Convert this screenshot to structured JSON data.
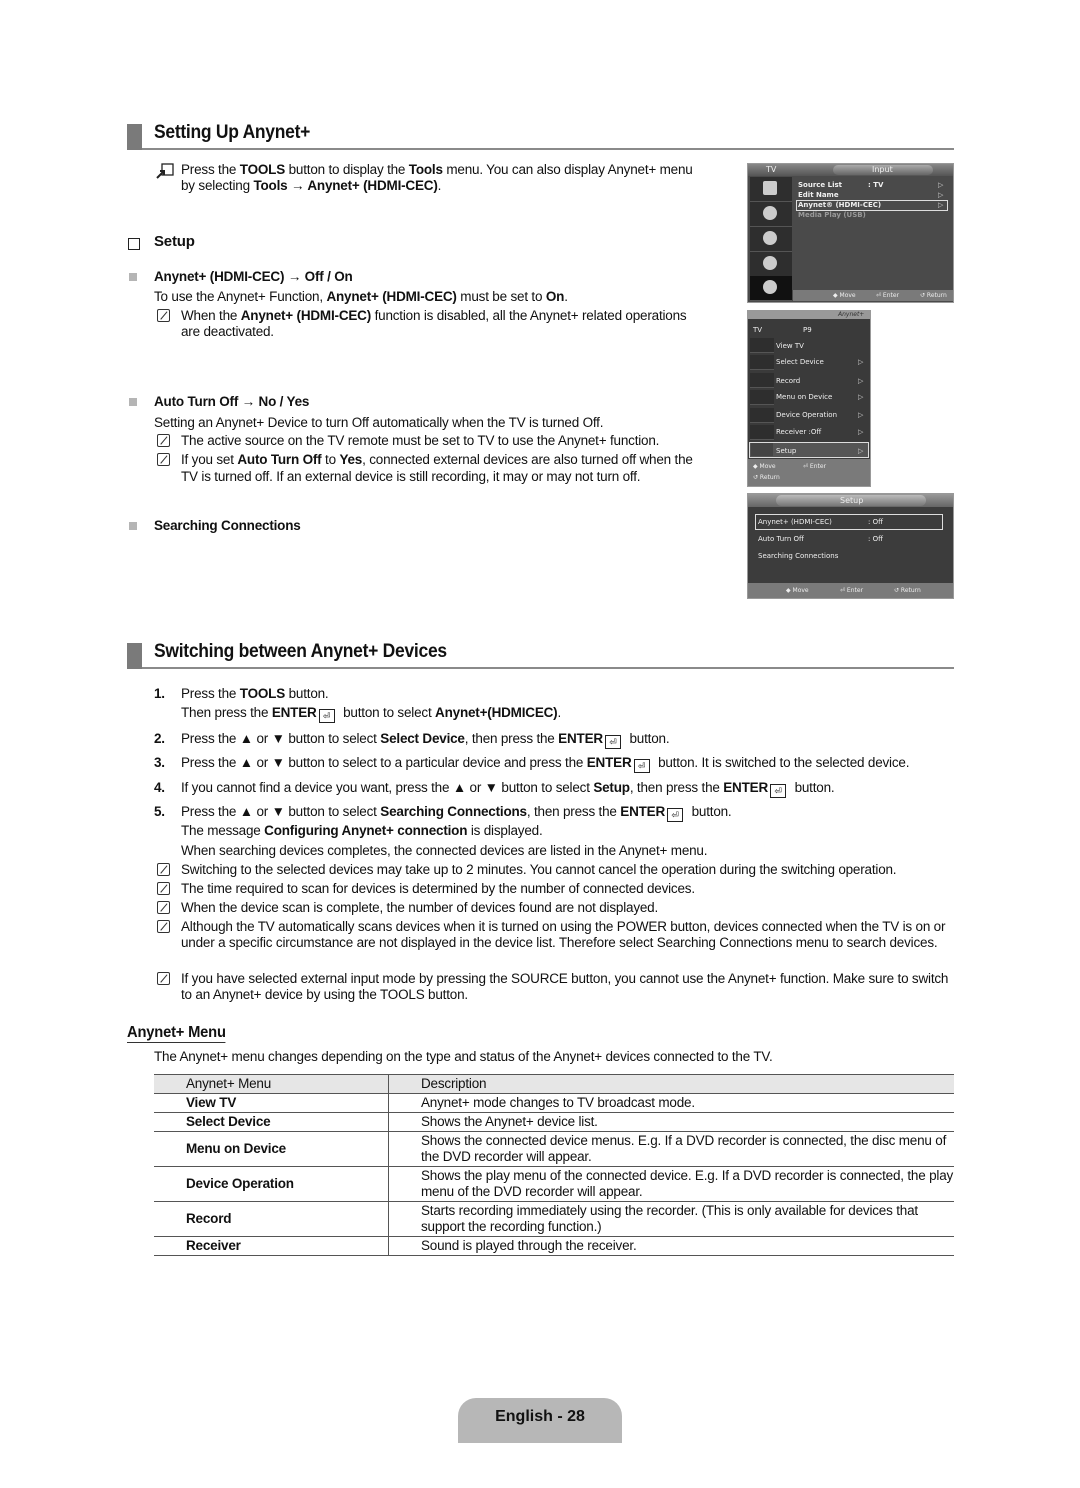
{
  "section1": {
    "title": "Setting Up Anynet+",
    "tools_note": [
      "Press the ",
      "TOOLS",
      " button to display the ",
      "Tools",
      " menu. You can also display Anynet+ menu",
      "by selecting ",
      "Tools → Anynet+ (HDMI-CEC)",
      "."
    ],
    "setup_heading": "Setup",
    "items": [
      {
        "label": "Anynet+ (HDMI-CEC) → Off / On",
        "desc": [
          "To use the Anynet+ Function, ",
          "Anynet+ (HDMI-CEC)",
          " must be set to ",
          "On",
          "."
        ],
        "notes": [
          [
            "When the ",
            "Anynet+ (HDMI-CEC)",
            " function is disabled, all the Anynet+ related operations",
            "are deactivated."
          ]
        ]
      },
      {
        "label": "Auto Turn Off → No / Yes",
        "desc": [
          "Setting an Anynet+ Device to turn Off automatically when the TV is turned Off."
        ],
        "notes": [
          [
            "The active source on the TV remote must be set to TV to use the Anynet+ function."
          ],
          [
            "If you set ",
            "Auto Turn Off",
            " to ",
            "Yes",
            ", connected external devices are also turned off when the",
            "TV is turned off. If an external device is still recording, it may or may not turn off."
          ]
        ]
      },
      {
        "label": "Searching Connections"
      }
    ]
  },
  "osd_input": {
    "tab_left": "TV",
    "tab_title": "Input",
    "items": [
      {
        "label": "Source List",
        "value": ": TV",
        "arrow": "▷"
      },
      {
        "label": "Edit Name",
        "value": "",
        "arrow": "▷"
      },
      {
        "label": "Anynet® (HDMI-CEC)",
        "value": "",
        "arrow": "▷",
        "selected": true
      },
      {
        "label": "Media Play (USB)",
        "value": "",
        "arrow": "",
        "dimmed": true
      }
    ],
    "footer": {
      "move": "◆ Move",
      "enter": "⏎ Enter",
      "return": "↺ Return"
    }
  },
  "osd_anynet": {
    "logo": "Anynet+",
    "header_left": "TV",
    "header_right": "P9",
    "items": [
      {
        "label": "View TV",
        "arrow": ""
      },
      {
        "label": "Select Device",
        "arrow": "▷"
      },
      {
        "label": "Record",
        "arrow": "▷"
      },
      {
        "label": "Menu on Device",
        "arrow": "▷"
      },
      {
        "label": "Device Operation",
        "arrow": "▷"
      },
      {
        "label": "Receiver :Off",
        "arrow": "▷"
      },
      {
        "label": "Setup",
        "arrow": "▷",
        "selected": true
      }
    ],
    "footer": {
      "move": "◆ Move",
      "enter": "⏎ Enter",
      "return": "↺ Return"
    }
  },
  "osd_setup": {
    "title": "Setup",
    "items": [
      {
        "label": "Anynet+ (HDMI-CEC)",
        "value": ": Off",
        "selected": true
      },
      {
        "label": "Auto Turn Off",
        "value": ": Off"
      },
      {
        "label": "Searching Connections",
        "value": ""
      }
    ],
    "footer": {
      "move": "◆ Move",
      "enter": "⏎ Enter",
      "return": "↺ Return"
    }
  },
  "section2": {
    "title": "Switching between Anynet+ Devices",
    "steps": [
      {
        "num": "1.",
        "lines": [
          [
            "Press the ",
            "TOOLS",
            " button."
          ],
          [
            "Then press the ",
            "ENTER",
            " button to select ",
            "Anynet+(HDMICEC)",
            "."
          ]
        ]
      },
      {
        "num": "2.",
        "lines": [
          [
            "Press the ▲ or ▼ button to select ",
            "Select Device",
            ", then press the ",
            "ENTER",
            " button."
          ]
        ]
      },
      {
        "num": "3.",
        "lines": [
          [
            "Press the ▲ or ▼ button to select to a particular device and press the ",
            "ENTER",
            " button. It is switched to the selected device."
          ]
        ]
      },
      {
        "num": "4.",
        "lines": [
          [
            "If you cannot find a device you want, press the ▲ or ▼ button to select ",
            "Setup",
            ", then press the ",
            "ENTER",
            " button."
          ]
        ]
      },
      {
        "num": "5.",
        "lines": [
          [
            "Press the ▲ or ▼ button to select ",
            "Searching Connections",
            ", then press the ",
            "ENTER",
            " button."
          ],
          [
            "The message ",
            "Configuring Anynet+ connection",
            " is displayed."
          ],
          [
            "When searching devices completes, the connected devices are listed in the Anynet+ menu."
          ]
        ]
      }
    ],
    "notes": [
      "Switching to the selected devices may take up to 2 minutes. You cannot cancel the operation during the switching operation.",
      "The time required to scan for devices is determined by the number of connected devices.",
      "When the device scan is complete, the number of devices found are not displayed.",
      "Although the TV automatically scans devices when it is turned on using the POWER button, devices connected when the TV is on or under a specific circumstance are not displayed in the device list. Therefore select Searching Connections menu to search devices.",
      "If you have selected external input mode by pressing the SOURCE button, you cannot use the Anynet+ function. Make sure to switch to an Anynet+ device by using the TOOLS button."
    ]
  },
  "menu_section": {
    "title": "Anynet+ Menu",
    "intro": "The Anynet+ menu changes depending on the type and status of the Anynet+ devices connected to the TV.",
    "table": {
      "headers": [
        "Anynet+ Menu",
        "Description"
      ],
      "rows": [
        [
          "View TV",
          "Anynet+ mode changes to TV broadcast mode."
        ],
        [
          "Select Device",
          "Shows the Anynet+ device list."
        ],
        [
          "Menu on Device",
          "Shows the connected device menus. E.g. If a DVD recorder is connected, the disc menu of the DVD recorder will appear."
        ],
        [
          "Device Operation",
          "Shows the play menu of the connected device. E.g. If a DVD recorder is connected, the play menu of the DVD recorder will appear."
        ],
        [
          "Record",
          "Starts recording immediately using the recorder. (This is only available for devices that support the recording function.)"
        ],
        [
          "Receiver",
          "Sound is played through the receiver."
        ]
      ]
    }
  },
  "footer": {
    "page_label": "English - 28"
  }
}
